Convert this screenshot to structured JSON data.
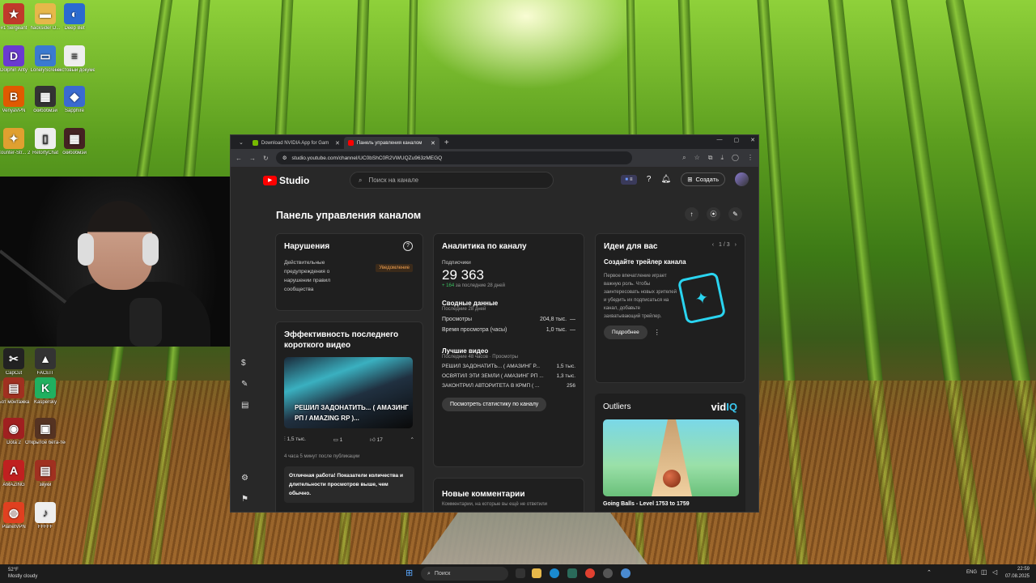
{
  "desktop": {
    "icons": [
      {
        "label": "#1 Sergeant",
        "color": "#c0392b",
        "glyph": "★"
      },
      {
        "label": "hacksider D...",
        "color": "#e6b84a",
        "glyph": "▬"
      },
      {
        "label": "Deep Bet",
        "color": "#2a6ad0",
        "glyph": "◐"
      },
      {
        "label": "Dolphin Anty",
        "color": "#6a3ad0",
        "glyph": "D"
      },
      {
        "label": "LonelyScreen",
        "color": "#3a7ad0",
        "glyph": "▭"
      },
      {
        "label": "Текстовый документ (2)",
        "color": "#eeeeee",
        "glyph": "≡"
      },
      {
        "label": "VenyaVPN",
        "color": "#e05a00",
        "glyph": "B"
      },
      {
        "label": "скибобмэй",
        "color": "#333333",
        "glyph": "▦"
      },
      {
        "label": "Sapphire",
        "color": "#3a6ad0",
        "glyph": "◆"
      },
      {
        "label": "Counter-Str... 2",
        "color": "#e0a030",
        "glyph": "✦"
      },
      {
        "label": "RetortyChat",
        "color": "#eeeeee",
        "glyph": "▯"
      },
      {
        "label": "скибобмэй",
        "color": "#442222",
        "glyph": "▦"
      },
      {
        "label": "CapCut",
        "color": "#222222",
        "glyph": "✂"
      },
      {
        "label": "FACEIT",
        "color": "#333333",
        "glyph": "▲"
      },
      {
        "label": "Бот монтажка",
        "color": "#a03020",
        "glyph": "▤"
      },
      {
        "label": "Kaspersky",
        "color": "#20b060",
        "glyph": "K"
      },
      {
        "label": "Dota 2",
        "color": "#a02020",
        "glyph": "◉"
      },
      {
        "label": "Открытое бета-тестир...",
        "color": "#553322",
        "glyph": "▣"
      },
      {
        "label": "AMAZING",
        "color": "#c02020",
        "glyph": "A"
      },
      {
        "label": "звуки",
        "color": "#a03020",
        "glyph": "▤"
      },
      {
        "label": "PlanetVPN",
        "color": "#e04020",
        "glyph": "◍"
      },
      {
        "label": "FFFFF",
        "color": "#eeeeee",
        "glyph": "♪"
      }
    ]
  },
  "browser": {
    "tabs": [
      {
        "label": "Download NVIDIA App for Gam",
        "fav_color": "#76b900"
      },
      {
        "label": "Панель управления каналом",
        "fav_color": "#ff0000"
      }
    ],
    "new_tab": "+",
    "url": "studio.youtube.com/channel/UC0bShC0R2VWUQZu963zMEGQ"
  },
  "studio": {
    "logo": "Studio",
    "search_placeholder": "Поиск на канале",
    "create_label": "Создать",
    "page_title": "Панель управления каналом",
    "violations": {
      "title": "Нарушения",
      "text": "Действительные предупреждения о нарушении правил сообщества",
      "tag": "Уведомление"
    },
    "short": {
      "title": "Эффективность последнего короткого видео",
      "caption": "РЕШИЛ ЗАДОНАТИТЬ... ( АМАЗИНГ РП / AMAZING RP )...",
      "views": "1,5 тыс.",
      "comments": "1",
      "likes": "17",
      "time": "4 часа 5 минут после публикации",
      "note": "Отличная работа! Показатели количества и длительности просмотров выше, чем обычно."
    },
    "analytics": {
      "title": "Аналитика по каналу",
      "subs_label": "Подписчики",
      "subs_value": "29 363",
      "subs_delta": "+ 164",
      "subs_delta_text": "за последние 28 дней",
      "summary_title": "Сводные данные",
      "summary_period": "Последние 28 дней",
      "rows": [
        {
          "label": "Просмотры",
          "value": "204,8 тыс.",
          "trend": "—"
        },
        {
          "label": "Время просмотра (часы)",
          "value": "1,0 тыс.",
          "trend": "—"
        }
      ],
      "top_title": "Лучшие видео",
      "top_period": "Последние 48 часов · Просмотры",
      "top": [
        {
          "label": "РЕШИЛ ЗАДОНАТИТЬ... ( АМАЗИНГ Р...",
          "value": "1,5 тыс."
        },
        {
          "label": "ОСВЯТИЛ ЭТИ ЗЕМЛИ ( АМАЗИНГ РП ...",
          "value": "1,3 тыс."
        },
        {
          "label": "ЗАКОНТРИЛ АВТОРИТЕТА В КРМП ( ...",
          "value": "256"
        }
      ],
      "button": "Посмотреть статистику по каналу"
    },
    "comments": {
      "title": "Новые комментарии",
      "sub": "Комментарии, на которые вы ещё не ответили"
    },
    "ideas": {
      "title": "Идеи для вас",
      "pager": "1 / 3",
      "card_title": "Создайте трейлер канала",
      "text": "Первое впечатление играет важную роль. Чтобы заинтересовать новых зрителей и убедить их подписаться на канал, добавьте захватывающий трейлер.",
      "button": "Подробнее"
    },
    "outliers": {
      "title": "Outliers",
      "brand_a": "vid",
      "brand_b": "IQ",
      "video": "Going Balls - Level 1753 to 1759"
    }
  },
  "taskbar": {
    "weather_temp": "52°F",
    "weather_text": "Mostly cloudy",
    "search": "Поиск",
    "lang": "ENG",
    "time": "22:59",
    "date": "07.08.2025"
  }
}
